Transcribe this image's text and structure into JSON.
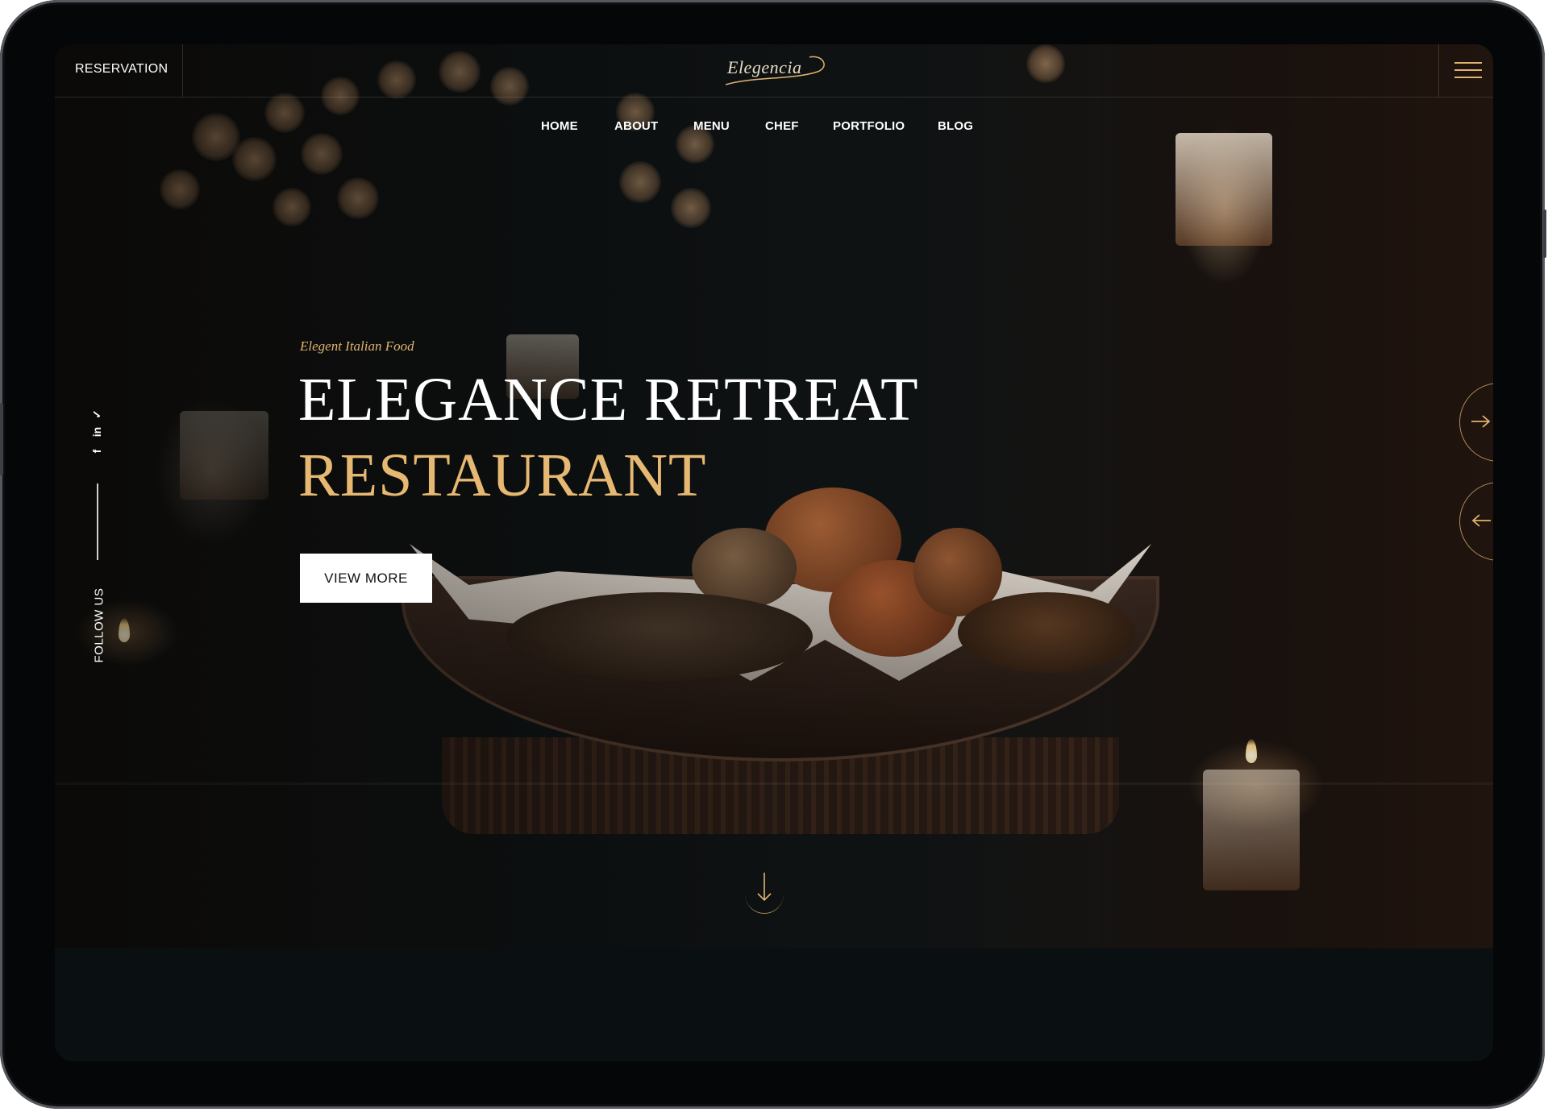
{
  "topbar": {
    "reservation_label": "RESERVATION",
    "logo_text": "Elegencia",
    "menu_icon": "hamburger-menu-icon"
  },
  "nav": {
    "items": [
      {
        "label": "HOME"
      },
      {
        "label": "ABOUT"
      },
      {
        "label": "MENU"
      },
      {
        "label": "CHEF"
      },
      {
        "label": "PORTFOLIO"
      },
      {
        "label": "BLOG"
      }
    ]
  },
  "hero": {
    "tagline": "Elegent Italian Food",
    "title_line1": "ELEGANCE RETREAT",
    "title_line2": "RESTAURANT",
    "cta_label": "VIEW MORE",
    "next_icon": "arrow-right-icon",
    "prev_icon": "arrow-left-icon",
    "scroll_icon": "arrow-down-icon"
  },
  "social": {
    "follow_label": "FOLLOW US",
    "icons": [
      "twitter-icon",
      "linkedin-icon",
      "facebook-icon"
    ],
    "twitter_glyph": "✓",
    "linkedin_glyph": "in",
    "facebook_glyph": "f"
  },
  "colors": {
    "accent_gold": "#e0b36f",
    "title_gold": "#e7b872",
    "background": "#0a0f11"
  }
}
